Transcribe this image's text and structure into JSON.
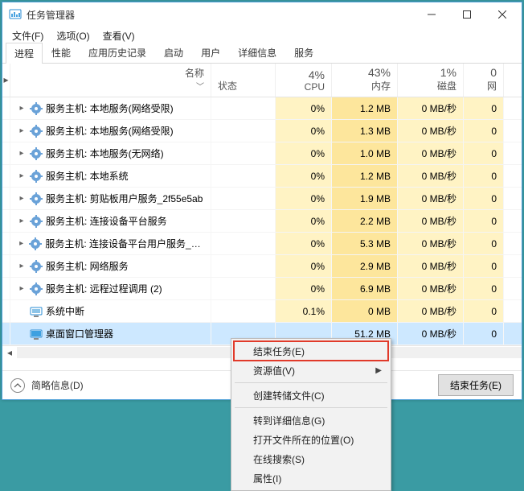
{
  "window": {
    "title": "任务管理器"
  },
  "menubar": {
    "file": "文件(F)",
    "options": "选项(O)",
    "view": "查看(V)"
  },
  "tabs": {
    "processes": "进程",
    "performance": "性能",
    "history": "应用历史记录",
    "startup": "启动",
    "users": "用户",
    "details": "详细信息",
    "services": "服务"
  },
  "columns": {
    "name": "名称",
    "status": "状态",
    "cpu_pct": "4%",
    "cpu": "CPU",
    "mem_pct": "43%",
    "mem": "内存",
    "disk_pct": "1%",
    "disk": "磁盘",
    "net_pct": "0",
    "net": "网"
  },
  "rows": [
    {
      "chev": "▸",
      "icon": "svc",
      "name": "服务主机: 本地服务(网络受限)",
      "cpu": "0%",
      "mem": "1.2 MB",
      "disk": "0 MB/秒",
      "net": "0"
    },
    {
      "chev": "▸",
      "icon": "svc",
      "name": "服务主机: 本地服务(网络受限)",
      "cpu": "0%",
      "mem": "1.3 MB",
      "disk": "0 MB/秒",
      "net": "0"
    },
    {
      "chev": "▸",
      "icon": "svc",
      "name": "服务主机: 本地服务(无网络)",
      "cpu": "0%",
      "mem": "1.0 MB",
      "disk": "0 MB/秒",
      "net": "0"
    },
    {
      "chev": "▸",
      "icon": "svc",
      "name": "服务主机: 本地系统",
      "cpu": "0%",
      "mem": "1.2 MB",
      "disk": "0 MB/秒",
      "net": "0"
    },
    {
      "chev": "▸",
      "icon": "svc",
      "name": "服务主机: 剪贴板用户服务_2f55e5ab",
      "cpu": "0%",
      "mem": "1.9 MB",
      "disk": "0 MB/秒",
      "net": "0"
    },
    {
      "chev": "▸",
      "icon": "svc",
      "name": "服务主机: 连接设备平台服务",
      "cpu": "0%",
      "mem": "2.2 MB",
      "disk": "0 MB/秒",
      "net": "0"
    },
    {
      "chev": "▸",
      "icon": "svc",
      "name": "服务主机: 连接设备平台用户服务_2f5...",
      "cpu": "0%",
      "mem": "5.3 MB",
      "disk": "0 MB/秒",
      "net": "0"
    },
    {
      "chev": "▸",
      "icon": "svc",
      "name": "服务主机: 网络服务",
      "cpu": "0%",
      "mem": "2.9 MB",
      "disk": "0 MB/秒",
      "net": "0"
    },
    {
      "chev": "▸",
      "icon": "svc",
      "name": "服务主机: 远程过程调用 (2)",
      "cpu": "0%",
      "mem": "6.9 MB",
      "disk": "0 MB/秒",
      "net": "0"
    },
    {
      "chev": "",
      "icon": "sys",
      "name": "系统中断",
      "cpu": "0.1%",
      "mem": "0 MB",
      "disk": "0 MB/秒",
      "net": "0"
    },
    {
      "chev": "",
      "icon": "dwm",
      "name": "桌面窗口管理器",
      "cpu": "",
      "mem": "51.2 MB",
      "disk": "0 MB/秒",
      "net": "0",
      "selected": true
    }
  ],
  "context_menu": {
    "end_task": "结束任务(E)",
    "resource_values": "资源值(V)",
    "create_dump": "创建转储文件(C)",
    "goto_details": "转到详细信息(G)",
    "open_location": "打开文件所在的位置(O)",
    "search_online": "在线搜索(S)",
    "properties": "属性(I)"
  },
  "footer": {
    "collapse": "简略信息(D)",
    "end_task_btn": "结束任务(E)"
  }
}
